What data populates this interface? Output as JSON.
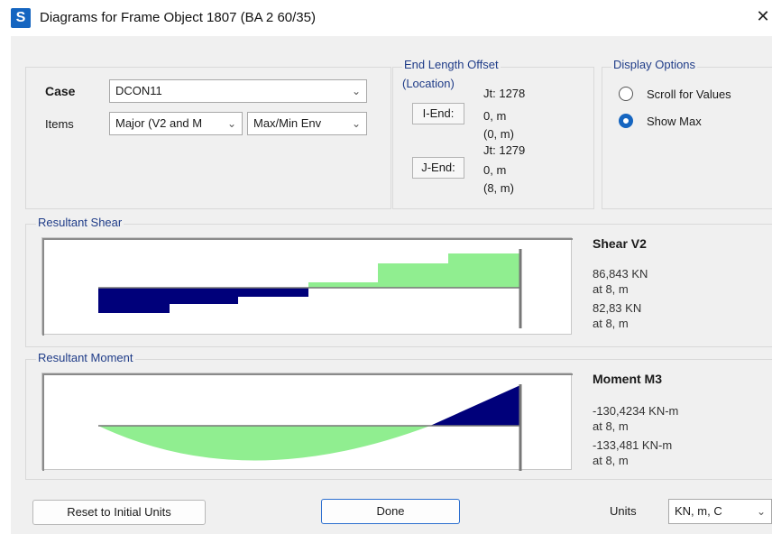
{
  "window": {
    "app_icon": "S",
    "title": "Diagrams for Frame Object 1807  (BA 2 60/35)",
    "close_glyph": "✕"
  },
  "case_section": {
    "case_label": "Case",
    "case_value": "DCON11",
    "items_label": "Items",
    "items_value": "Major (V2 and M",
    "env_value": "Max/Min Env"
  },
  "end_offset": {
    "group_title_line1": "End Length Offset",
    "group_title_line2": "(Location)",
    "i_end": {
      "button": "I-End:",
      "jt": "Jt:  1278",
      "value": "0, m",
      "location": "(0, m)"
    },
    "j_end": {
      "button": "J-End:",
      "jt": "Jt:  1279",
      "value": "0, m",
      "location": "(8, m)"
    }
  },
  "display_options": {
    "group_title": "Display Options",
    "options": [
      {
        "label": "Scroll for Values",
        "checked": false
      },
      {
        "label": "Show Max",
        "checked": true
      }
    ]
  },
  "shear": {
    "group_title": "Resultant Shear",
    "title": "Shear V2",
    "max_value": "86,843 KN",
    "max_at": "at 8, m",
    "min_value": "82,83 KN",
    "min_at": "at 8, m"
  },
  "moment": {
    "group_title": "Resultant Moment",
    "title": "Moment M3",
    "max_value": "-130,4234 KN-m",
    "max_at": "at 8, m",
    "min_value": "-133,481 KN-m",
    "min_at": "at 8, m"
  },
  "footer": {
    "reset_label": "Reset to Initial Units",
    "done_label": "Done",
    "units_label": "Units",
    "units_value": "KN, m, C"
  },
  "colors": {
    "positive_fill": "#90ee90",
    "negative_fill": "#00007a",
    "accent": "#1565c0",
    "group_title": "#1f3c88"
  }
}
